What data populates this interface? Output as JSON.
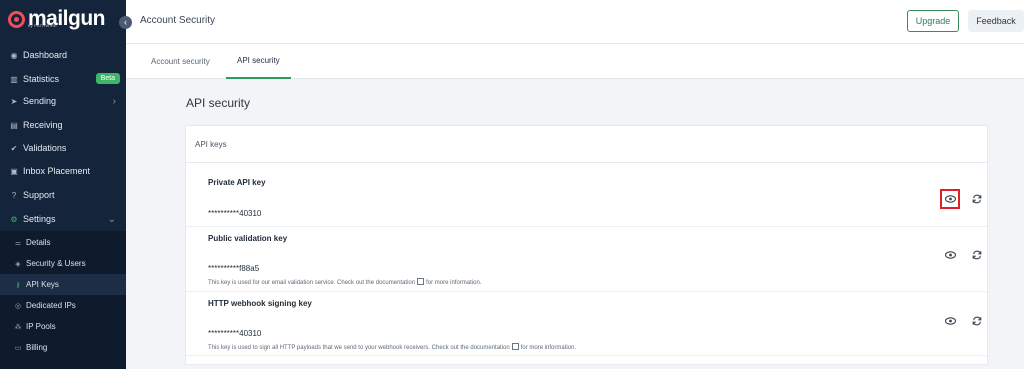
{
  "brand": {
    "name": "mailgun",
    "byline": "by PATHWIRE"
  },
  "sidebar": {
    "items": [
      {
        "label": "Dashboard",
        "icon": "dashboard-icon"
      },
      {
        "label": "Statistics",
        "icon": "bar-chart-icon",
        "badge": "Beta"
      },
      {
        "label": "Sending",
        "icon": "send-icon"
      },
      {
        "label": "Receiving",
        "icon": "inbox-icon"
      },
      {
        "label": "Validations",
        "icon": "check-user-icon"
      },
      {
        "label": "Inbox Placement",
        "icon": "placement-icon"
      },
      {
        "label": "Support",
        "icon": "support-icon"
      },
      {
        "label": "Settings",
        "icon": "gear-icon"
      }
    ],
    "settings_items": [
      {
        "label": "Details",
        "icon": "sliders-icon"
      },
      {
        "label": "Security & Users",
        "icon": "shield-icon"
      },
      {
        "label": "API Keys",
        "icon": "key-icon",
        "active": true
      },
      {
        "label": "Dedicated IPs",
        "icon": "target-icon"
      },
      {
        "label": "IP Pools",
        "icon": "pool-icon"
      },
      {
        "label": "Billing",
        "icon": "billing-icon"
      }
    ]
  },
  "header": {
    "title": "Account Security",
    "upgrade_label": "Upgrade",
    "feedback_label": "Feedback"
  },
  "tabs": [
    {
      "label": "Account security",
      "active": false
    },
    {
      "label": "API security",
      "active": true
    }
  ],
  "main": {
    "section_title": "API security",
    "card_title": "API keys",
    "keys": [
      {
        "name": "Private API key",
        "value": "**********40310",
        "help": null
      },
      {
        "name": "Public validation key",
        "value": "**********f88a5",
        "help_before": "This key is used for our email validation service. Check out the documentation",
        "help_after": "for more information."
      },
      {
        "name": "HTTP webhook signing key",
        "value": "**********40310",
        "help_before": "This key is used to sign all HTTP payloads that we send to your webhook receivers. Check out the documentation",
        "help_after": "for more information."
      }
    ]
  },
  "colors": {
    "sidebar": "#14243a",
    "accent": "#2e9a5a",
    "beta_badge": "#3fb56a",
    "highlight": "#e01f26",
    "brand": "#f04e5b"
  }
}
